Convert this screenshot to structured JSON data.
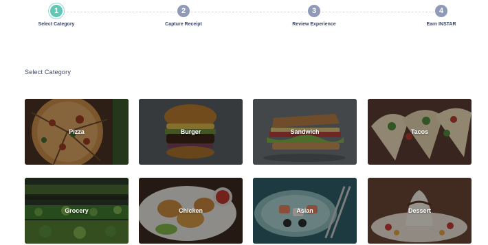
{
  "steps": [
    {
      "number": "1",
      "label": "Select Category",
      "active": true
    },
    {
      "number": "2",
      "label": "Capture Receipt",
      "active": false
    },
    {
      "number": "3",
      "label": "Review Experience",
      "active": false
    },
    {
      "number": "4",
      "label": "Earn INSTAR",
      "active": false
    }
  ],
  "section_title": "Select Category",
  "categories": [
    {
      "label": "Pizza",
      "icon": "pizza-image"
    },
    {
      "label": "Burger",
      "icon": "burger-image"
    },
    {
      "label": "Sandwich",
      "icon": "sandwich-image"
    },
    {
      "label": "Tacos",
      "icon": "tacos-image"
    },
    {
      "label": "Grocery",
      "icon": "grocery-image"
    },
    {
      "label": "Chicken",
      "icon": "chicken-image"
    },
    {
      "label": "Asian",
      "icon": "asian-image"
    },
    {
      "label": "Dessert",
      "icon": "dessert-image"
    }
  ],
  "colors": {
    "active_step": "#5fc9b5",
    "inactive_step": "#8e9ab8",
    "text_dark": "#3b4467"
  }
}
